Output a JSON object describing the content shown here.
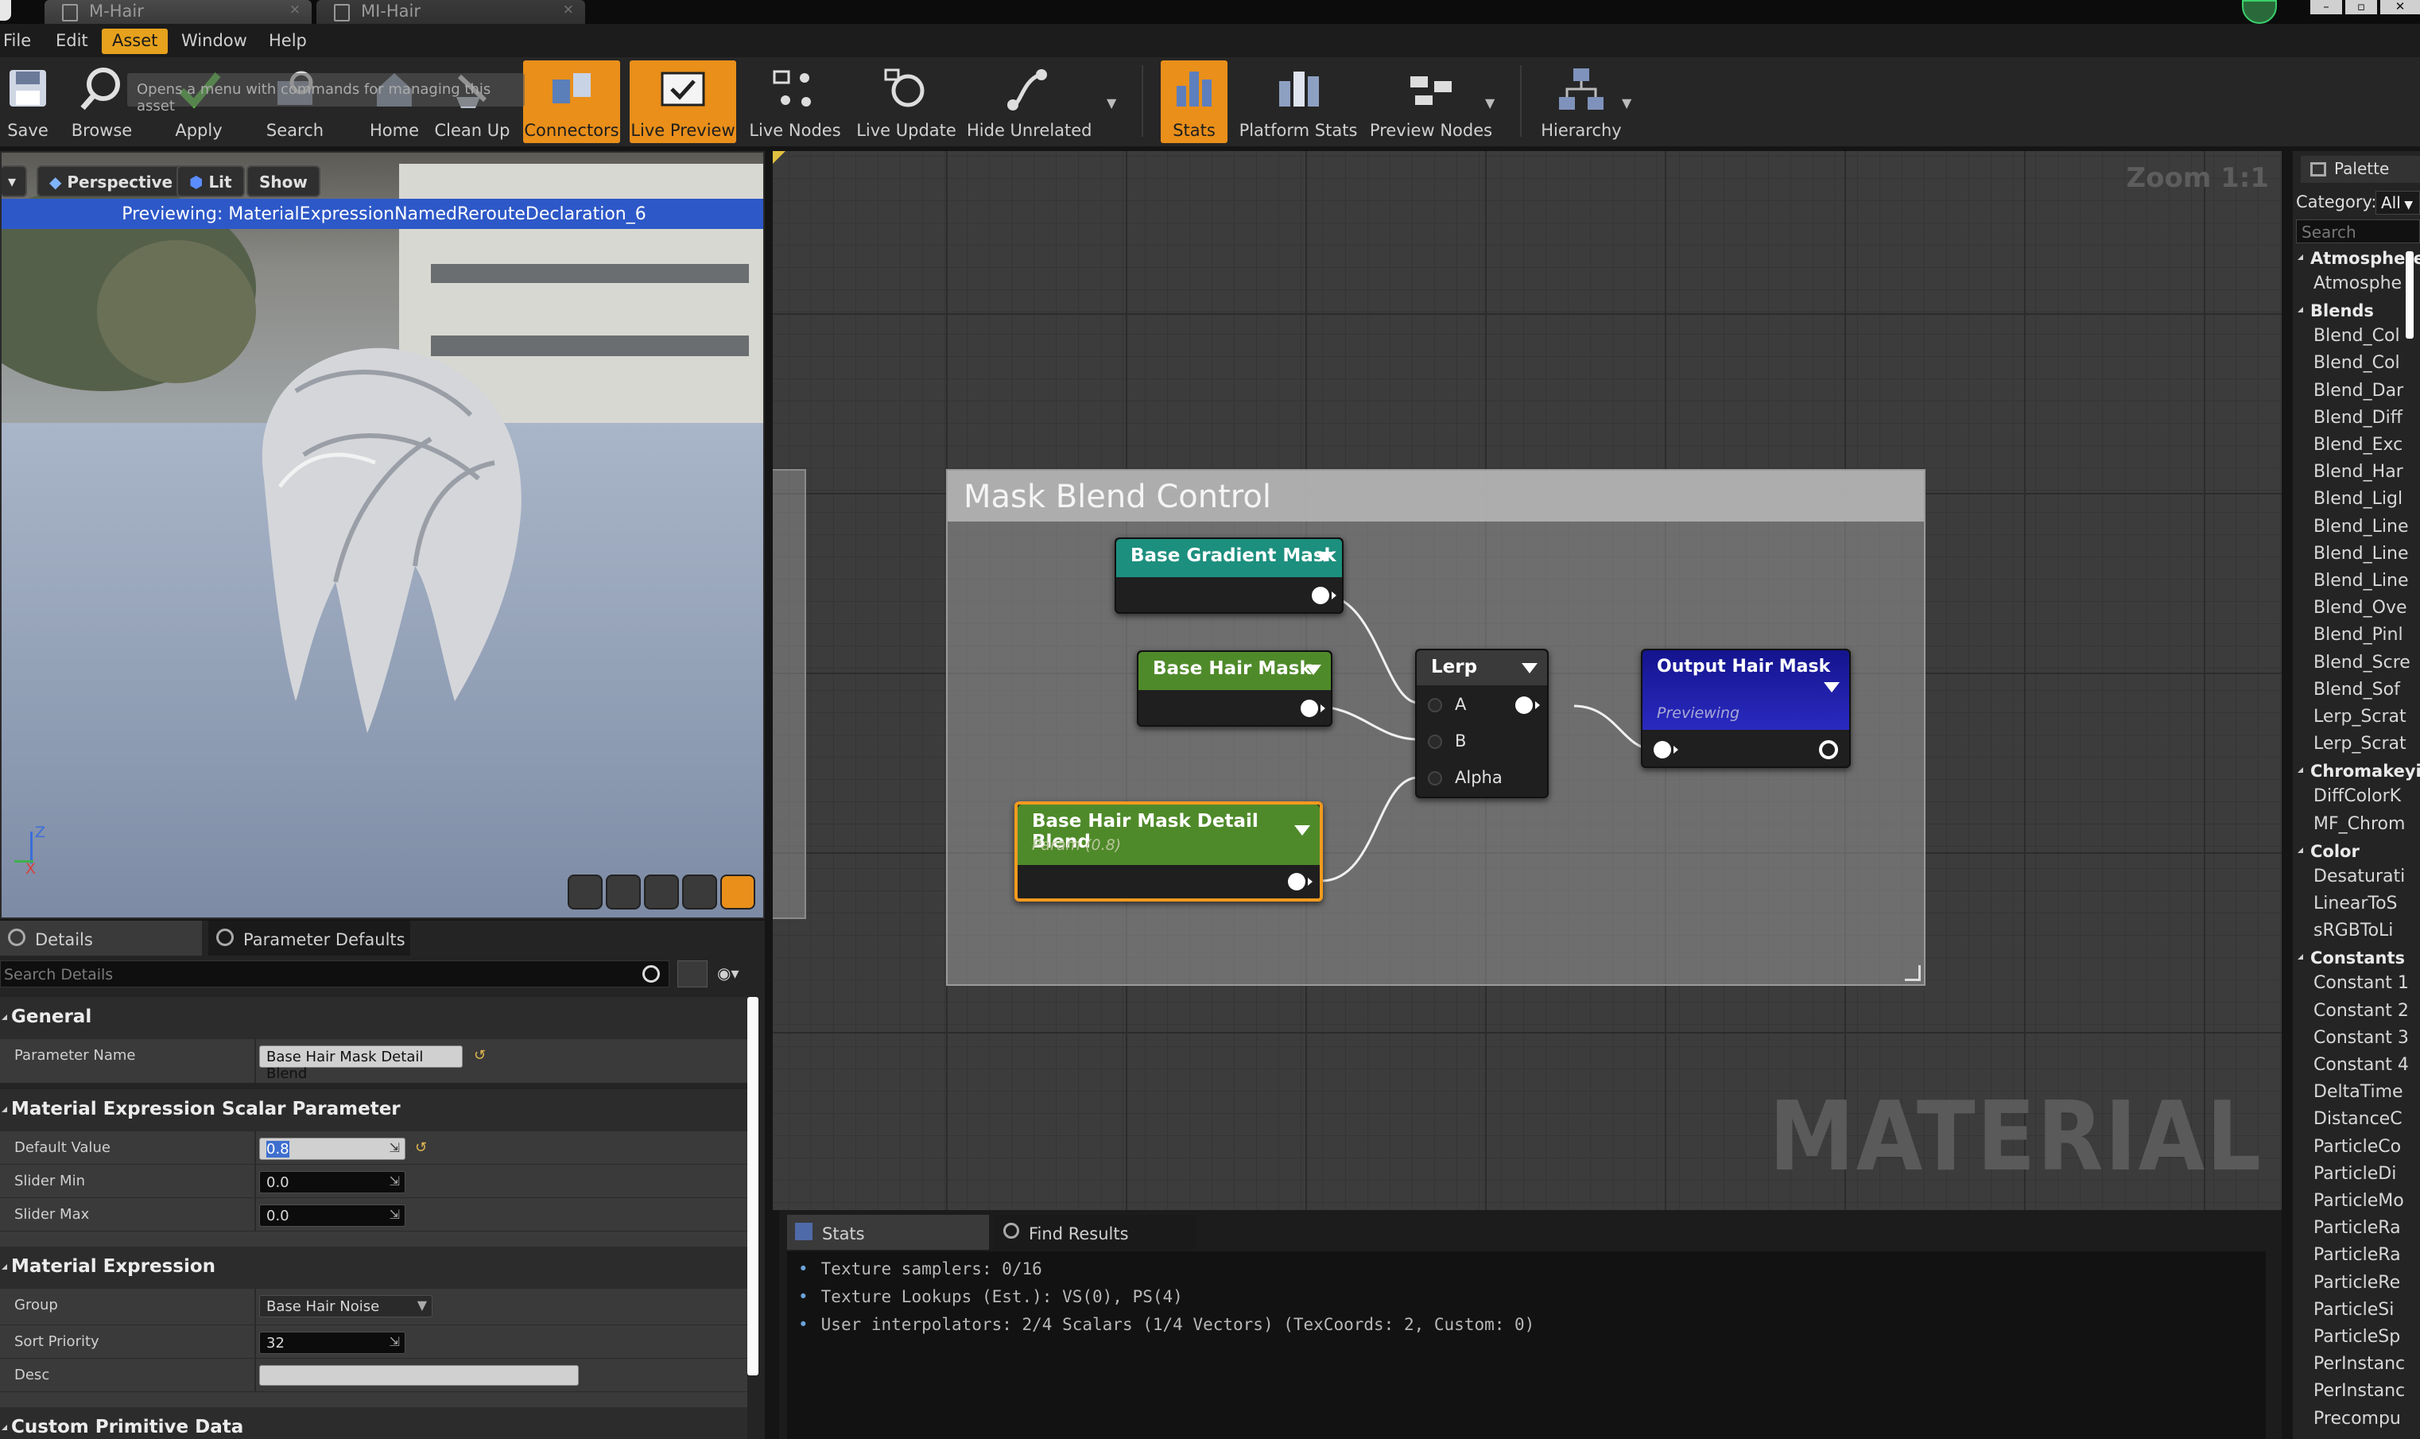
{
  "tabs": [
    {
      "label": "M-Hair",
      "active": true
    },
    {
      "label": "MI-Hair",
      "active": false
    }
  ],
  "menu": [
    "File",
    "Edit",
    "Asset",
    "Window",
    "Help"
  ],
  "menu_active": "Asset",
  "toolbar": {
    "hint": "Opens a menu with commands for managing this asset",
    "buttons": [
      {
        "label": "Save",
        "icon": "save-icon",
        "on": false
      },
      {
        "label": "Browse",
        "icon": "browse-icon",
        "on": false
      },
      {
        "label": "Apply",
        "icon": "apply-icon",
        "on": false
      },
      {
        "label": "Search",
        "icon": "search-icon",
        "on": false
      },
      {
        "label": "Home",
        "icon": "home-icon",
        "on": false
      },
      {
        "label": "Clean Up",
        "icon": "cleanup-icon",
        "on": false
      },
      {
        "label": "Connectors",
        "icon": "connectors-icon",
        "on": true
      },
      {
        "label": "Live Preview",
        "icon": "live-preview-icon",
        "on": true
      },
      {
        "label": "Live Nodes",
        "icon": "live-nodes-icon",
        "on": false
      },
      {
        "label": "Live Update",
        "icon": "live-update-icon",
        "on": false
      },
      {
        "label": "Hide Unrelated",
        "icon": "hide-unrelated-icon",
        "on": false
      },
      {
        "label": "Stats",
        "icon": "stats-icon",
        "on": true
      },
      {
        "label": "Platform Stats",
        "icon": "platform-stats-icon",
        "on": false
      },
      {
        "label": "Preview Nodes",
        "icon": "preview-nodes-icon",
        "on": false
      },
      {
        "label": "Hierarchy",
        "icon": "hierarchy-icon",
        "on": false
      }
    ]
  },
  "viewport": {
    "perspective": "Perspective",
    "lit": "Lit",
    "show": "Show",
    "previewing": "Previewing: MaterialExpressionNamedRerouteDeclaration_6",
    "axis_z": "Z",
    "axis_x": "X"
  },
  "details": {
    "tab_details": "Details",
    "tab_params": "Parameter Defaults",
    "search_placeholder": "Search Details",
    "general": "General",
    "parameter_name_label": "Parameter Name",
    "parameter_name_value": "Base Hair Mask Detail Blend",
    "scalar_section": "Material Expression Scalar Parameter",
    "default_value_label": "Default Value",
    "default_value": "0.8",
    "slider_min_label": "Slider Min",
    "slider_min": "0.0",
    "slider_max_label": "Slider Max",
    "slider_max": "0.0",
    "expression_section": "Material Expression",
    "group_label": "Group",
    "group_value": "Base Hair Noise",
    "sort_priority_label": "Sort Priority",
    "sort_priority": "32",
    "desc_label": "Desc",
    "custom_primitive_section": "Custom Primitive Data"
  },
  "graph": {
    "zoom": "Zoom 1:1",
    "watermark": "MATERIAL",
    "comment": "Mask Blend Control",
    "nodes": {
      "gradient": {
        "title": "Base Gradient Mask",
        "color": "#1d8f7e"
      },
      "hairmask": {
        "title": "Base Hair Mask",
        "color": "#4f8a2a"
      },
      "detail": {
        "title": "Base Hair Mask Detail Blend",
        "subtitle": "Param (0.8)",
        "color": "#4f8a2a"
      },
      "lerp": {
        "title": "Lerp",
        "pin_a": "A",
        "pin_b": "B",
        "pin_alpha": "Alpha"
      },
      "output": {
        "title": "Output Hair Mask",
        "subtitle": "Previewing",
        "color": "#1a1a9a"
      }
    }
  },
  "stats": {
    "tab_stats": "Stats",
    "tab_find": "Find Results",
    "lines": [
      "Texture samplers: 0/16",
      "Texture Lookups (Est.): VS(0), PS(4)",
      "User interpolators: 2/4 Scalars (1/4 Vectors) (TexCoords: 2, Custom: 0)"
    ]
  },
  "palette": {
    "title": "Palette",
    "category_label": "Category:",
    "category_value": "All",
    "search_placeholder": "Search",
    "entries": [
      {
        "type": "cat",
        "text": "Atmosphere"
      },
      {
        "type": "item",
        "text": "Atmosphe"
      },
      {
        "type": "cat",
        "text": "Blends"
      },
      {
        "type": "item",
        "text": "Blend_Col"
      },
      {
        "type": "item",
        "text": "Blend_Col"
      },
      {
        "type": "item",
        "text": "Blend_Dar"
      },
      {
        "type": "item",
        "text": "Blend_Diff"
      },
      {
        "type": "item",
        "text": "Blend_Exc"
      },
      {
        "type": "item",
        "text": "Blend_Har"
      },
      {
        "type": "item",
        "text": "Blend_Ligl"
      },
      {
        "type": "item",
        "text": "Blend_Line"
      },
      {
        "type": "item",
        "text": "Blend_Line"
      },
      {
        "type": "item",
        "text": "Blend_Line"
      },
      {
        "type": "item",
        "text": "Blend_Ove"
      },
      {
        "type": "item",
        "text": "Blend_Pinl"
      },
      {
        "type": "item",
        "text": "Blend_Scre"
      },
      {
        "type": "item",
        "text": "Blend_Sof"
      },
      {
        "type": "item",
        "text": "Lerp_Scrat"
      },
      {
        "type": "item",
        "text": "Lerp_Scrat"
      },
      {
        "type": "cat",
        "text": "Chromakeyin"
      },
      {
        "type": "item",
        "text": "DiffColorK"
      },
      {
        "type": "item",
        "text": "MF_Chrom"
      },
      {
        "type": "cat",
        "text": "Color"
      },
      {
        "type": "item",
        "text": "Desaturati"
      },
      {
        "type": "item",
        "text": "LinearToS"
      },
      {
        "type": "item",
        "text": "sRGBToLi"
      },
      {
        "type": "cat",
        "text": "Constants"
      },
      {
        "type": "item",
        "text": "Constant 1"
      },
      {
        "type": "item",
        "text": "Constant 2"
      },
      {
        "type": "item",
        "text": "Constant 3"
      },
      {
        "type": "item",
        "text": "Constant 4"
      },
      {
        "type": "item",
        "text": "DeltaTime"
      },
      {
        "type": "item",
        "text": "DistanceC"
      },
      {
        "type": "item",
        "text": "ParticleCo"
      },
      {
        "type": "item",
        "text": "ParticleDi"
      },
      {
        "type": "item",
        "text": "ParticleMo"
      },
      {
        "type": "item",
        "text": "ParticleRa"
      },
      {
        "type": "item",
        "text": "ParticleRa"
      },
      {
        "type": "item",
        "text": "ParticleRe"
      },
      {
        "type": "item",
        "text": "ParticleSi"
      },
      {
        "type": "item",
        "text": "ParticleSp"
      },
      {
        "type": "item",
        "text": "PerInstanc"
      },
      {
        "type": "item",
        "text": "PerInstanc"
      },
      {
        "type": "item",
        "text": "Precompu"
      }
    ]
  }
}
